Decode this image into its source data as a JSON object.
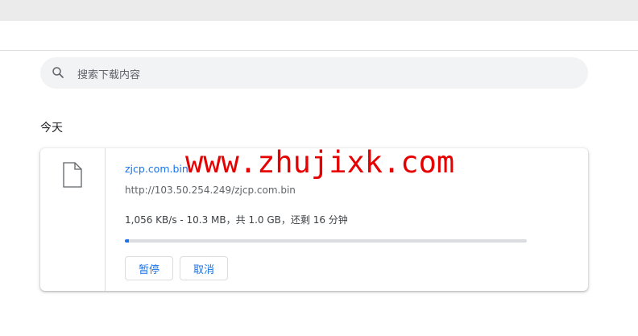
{
  "search": {
    "placeholder": "搜索下载内容",
    "icon": "search-icon"
  },
  "section": {
    "title": "今天"
  },
  "download": {
    "file_name": "zjcp.com.bin",
    "url": "http://103.50.254.249/zjcp.com.bin",
    "status": "1,056 KB/s - 10.3 MB，共 1.0 GB，还剩 16 分钟",
    "progress_fraction": 0.01,
    "file_icon": "file-icon",
    "pause_label": "暂停",
    "cancel_label": "取消"
  },
  "watermark": {
    "text": "www.zhujixk.com"
  },
  "colors": {
    "accent": "#1a73e8",
    "watermark": "#e60000",
    "search_bg": "#f1f3f4"
  }
}
